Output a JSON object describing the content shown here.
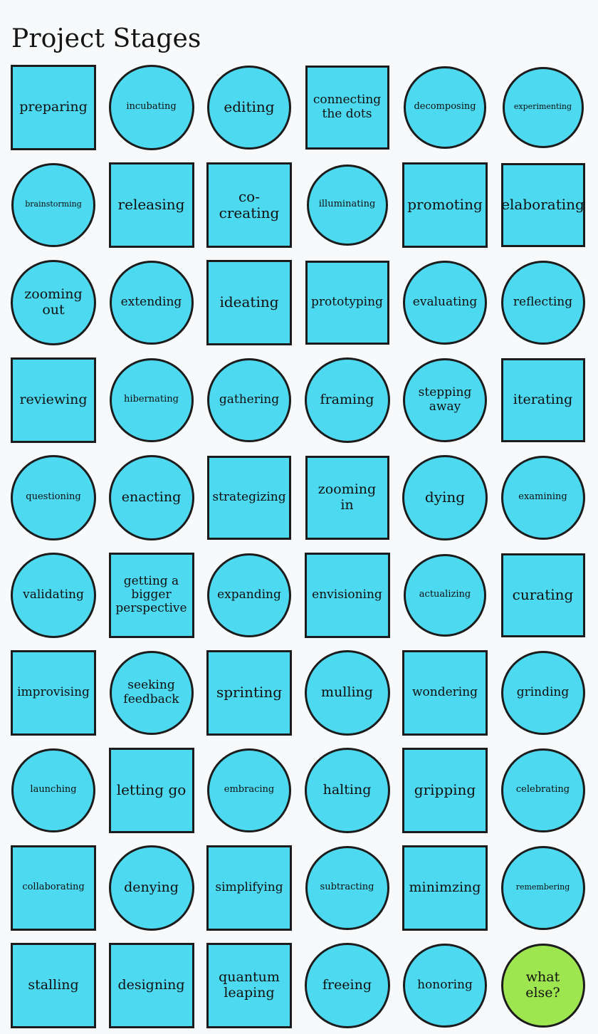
{
  "page": {
    "title": "Project Stages",
    "background_color": "#f8f9fa",
    "shape_fill_color": "#4dd9f0",
    "accent_fill_color": "#9ee64f",
    "shape_stroke_color": "#1c1c1c",
    "text_color": "#101010",
    "columns": 6,
    "rows": 10
  },
  "grid": {
    "rows": [
      {
        "cells": [
          {
            "label": "preparing",
            "shape": "square",
            "size": 120,
            "text": "lg",
            "accent": false
          },
          {
            "label": "incubating",
            "shape": "circle",
            "size": 120,
            "text": "sm",
            "accent": false
          },
          {
            "label": "editing",
            "shape": "circle",
            "size": 118,
            "text": "xl",
            "accent": false
          },
          {
            "label": "connecting\nthe dots",
            "shape": "square",
            "size": 118,
            "text": "md",
            "accent": false
          },
          {
            "label": "decomposing",
            "shape": "circle",
            "size": 116,
            "text": "sm",
            "accent": false
          },
          {
            "label": "experimenting",
            "shape": "circle",
            "size": 114,
            "text": "xs",
            "accent": false
          }
        ]
      },
      {
        "cells": [
          {
            "label": "brainstorming",
            "shape": "circle",
            "size": 118,
            "text": "xs",
            "accent": false
          },
          {
            "label": "releasing",
            "shape": "square",
            "size": 120,
            "text": "xl",
            "accent": false
          },
          {
            "label": "co-\ncreating",
            "shape": "square",
            "size": 120,
            "text": "xl",
            "accent": false
          },
          {
            "label": "illuminating",
            "shape": "circle",
            "size": 114,
            "text": "sm",
            "accent": false
          },
          {
            "label": "promoting",
            "shape": "square",
            "size": 120,
            "text": "xl",
            "accent": false
          },
          {
            "label": "elaborating",
            "shape": "square",
            "size": 118,
            "text": "xl",
            "accent": false
          }
        ]
      },
      {
        "cells": [
          {
            "label": "zooming\nout",
            "shape": "circle",
            "size": 120,
            "text": "lg",
            "accent": false
          },
          {
            "label": "extending",
            "shape": "circle",
            "size": 118,
            "text": "md",
            "accent": false
          },
          {
            "label": "ideating",
            "shape": "square",
            "size": 120,
            "text": "xl",
            "accent": false
          },
          {
            "label": "prototyping",
            "shape": "square",
            "size": 118,
            "text": "md",
            "accent": false
          },
          {
            "label": "evaluating",
            "shape": "circle",
            "size": 118,
            "text": "md",
            "accent": false
          },
          {
            "label": "reflecting",
            "shape": "circle",
            "size": 118,
            "text": "md",
            "accent": false
          }
        ]
      },
      {
        "cells": [
          {
            "label": "reviewing",
            "shape": "square",
            "size": 120,
            "text": "lg",
            "accent": false
          },
          {
            "label": "hibernating",
            "shape": "circle",
            "size": 118,
            "text": "sm",
            "accent": false
          },
          {
            "label": "gathering",
            "shape": "circle",
            "size": 118,
            "text": "md",
            "accent": false
          },
          {
            "label": "framing",
            "shape": "circle",
            "size": 120,
            "text": "lg",
            "accent": false
          },
          {
            "label": "stepping\naway",
            "shape": "circle",
            "size": 118,
            "text": "md",
            "accent": false
          },
          {
            "label": "iterating",
            "shape": "square",
            "size": 118,
            "text": "lg",
            "accent": false
          }
        ]
      },
      {
        "cells": [
          {
            "label": "questioning",
            "shape": "circle",
            "size": 120,
            "text": "sm",
            "accent": false
          },
          {
            "label": "enacting",
            "shape": "circle",
            "size": 120,
            "text": "lg",
            "accent": false
          },
          {
            "label": "strategizing",
            "shape": "square",
            "size": 118,
            "text": "md",
            "accent": false
          },
          {
            "label": "zooming\nin",
            "shape": "square",
            "size": 118,
            "text": "lg",
            "accent": false
          },
          {
            "label": "dying",
            "shape": "circle",
            "size": 120,
            "text": "xl",
            "accent": false
          },
          {
            "label": "examining",
            "shape": "circle",
            "size": 118,
            "text": "sm",
            "accent": false
          }
        ]
      },
      {
        "cells": [
          {
            "label": "validating",
            "shape": "circle",
            "size": 120,
            "text": "md",
            "accent": false
          },
          {
            "label": "getting a\nbigger\nperspective",
            "shape": "square",
            "size": 120,
            "text": "md",
            "accent": false
          },
          {
            "label": "expanding",
            "shape": "circle",
            "size": 118,
            "text": "md",
            "accent": false
          },
          {
            "label": "envisioning",
            "shape": "square",
            "size": 120,
            "text": "md",
            "accent": false
          },
          {
            "label": "actualizing",
            "shape": "circle",
            "size": 116,
            "text": "sm",
            "accent": false
          },
          {
            "label": "curating",
            "shape": "square",
            "size": 118,
            "text": "xl",
            "accent": false
          }
        ]
      },
      {
        "cells": [
          {
            "label": "improvising",
            "shape": "square",
            "size": 120,
            "text": "md",
            "accent": false
          },
          {
            "label": "seeking\nfeedback",
            "shape": "circle",
            "size": 118,
            "text": "md",
            "accent": false
          },
          {
            "label": "sprinting",
            "shape": "square",
            "size": 120,
            "text": "xl",
            "accent": false
          },
          {
            "label": "mulling",
            "shape": "circle",
            "size": 120,
            "text": "lg",
            "accent": false
          },
          {
            "label": "wondering",
            "shape": "square",
            "size": 120,
            "text": "md",
            "accent": false
          },
          {
            "label": "grinding",
            "shape": "circle",
            "size": 118,
            "text": "md",
            "accent": false
          }
        ]
      },
      {
        "cells": [
          {
            "label": "launching",
            "shape": "circle",
            "size": 118,
            "text": "sm",
            "accent": false
          },
          {
            "label": "letting go",
            "shape": "square",
            "size": 120,
            "text": "xl",
            "accent": false
          },
          {
            "label": "embracing",
            "shape": "circle",
            "size": 118,
            "text": "sm",
            "accent": false
          },
          {
            "label": "halting",
            "shape": "circle",
            "size": 120,
            "text": "lg",
            "accent": false
          },
          {
            "label": "gripping",
            "shape": "square",
            "size": 120,
            "text": "xl",
            "accent": false
          },
          {
            "label": "celebrating",
            "shape": "circle",
            "size": 118,
            "text": "sm",
            "accent": false
          }
        ]
      },
      {
        "cells": [
          {
            "label": "collaborating",
            "shape": "square",
            "size": 120,
            "text": "sm",
            "accent": false
          },
          {
            "label": "denying",
            "shape": "circle",
            "size": 120,
            "text": "lg",
            "accent": false
          },
          {
            "label": "simplifying",
            "shape": "square",
            "size": 120,
            "text": "md",
            "accent": false
          },
          {
            "label": "subtracting",
            "shape": "circle",
            "size": 118,
            "text": "sm",
            "accent": false
          },
          {
            "label": "minimzing",
            "shape": "square",
            "size": 120,
            "text": "lg",
            "accent": false
          },
          {
            "label": "remembering",
            "shape": "circle",
            "size": 118,
            "text": "xs",
            "accent": false
          }
        ]
      },
      {
        "cells": [
          {
            "label": "stalling",
            "shape": "square",
            "size": 120,
            "text": "lg",
            "accent": false
          },
          {
            "label": "designing",
            "shape": "square",
            "size": 120,
            "text": "lg",
            "accent": false
          },
          {
            "label": "quantum\nleaping",
            "shape": "square",
            "size": 120,
            "text": "lg",
            "accent": false
          },
          {
            "label": "freeing",
            "shape": "circle",
            "size": 120,
            "text": "lg",
            "accent": false
          },
          {
            "label": "honoring",
            "shape": "circle",
            "size": 118,
            "text": "md",
            "accent": false
          },
          {
            "label": "what\nelse?",
            "shape": "circle",
            "size": 118,
            "text": "lg",
            "accent": true
          }
        ]
      }
    ]
  }
}
